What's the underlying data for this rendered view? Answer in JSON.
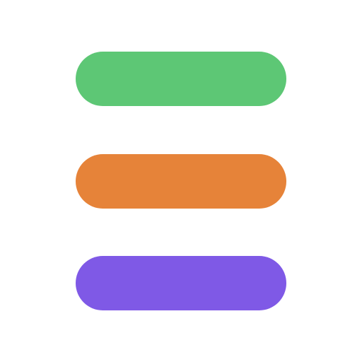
{
  "icon": {
    "name": "menu-bars-icon",
    "bars": [
      {
        "name": "green-bar",
        "color": "#5dc775"
      },
      {
        "name": "orange-bar",
        "color": "#e68339"
      },
      {
        "name": "purple-bar",
        "color": "#7f59e6"
      }
    ]
  }
}
